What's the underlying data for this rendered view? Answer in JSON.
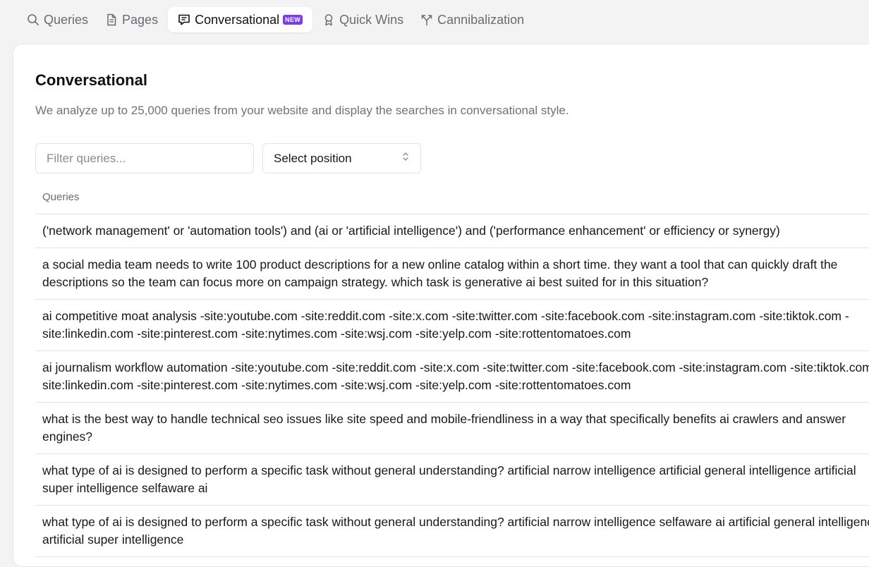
{
  "tabs": [
    {
      "label": "Queries",
      "icon": "search-icon",
      "active": false
    },
    {
      "label": "Pages",
      "icon": "page-icon",
      "active": false
    },
    {
      "label": "Conversational",
      "icon": "chat-icon",
      "active": true,
      "badge": "NEW"
    },
    {
      "label": "Quick Wins",
      "icon": "award-icon",
      "active": false
    },
    {
      "label": "Cannibalization",
      "icon": "split-icon",
      "active": false
    }
  ],
  "panel": {
    "title": "Conversational",
    "subtitle": "We analyze up to 25,000 queries from your website and display the searches in conversational style.",
    "filter_placeholder": "Filter queries...",
    "select_label": "Select position",
    "column_header": "Queries"
  },
  "rows": [
    "('network management' or 'automation tools') and (ai or 'artificial intelligence') and ('performance enhancement' or efficiency or synergy)",
    "a social media team needs to write 100 product descriptions for a new online catalog within a short time. they want a tool that can quickly draft the descriptions so the team can focus more on campaign strategy. which task is generative ai best suited for in this situation?",
    "ai competitive moat analysis -site:youtube.com -site:reddit.com -site:x.com -site:twitter.com -site:facebook.com -site:instagram.com -site:tiktok.com -site:linkedin.com -site:pinterest.com -site:nytimes.com -site:wsj.com -site:yelp.com -site:rottentomatoes.com",
    "ai journalism workflow automation -site:youtube.com -site:reddit.com -site:x.com -site:twitter.com -site:facebook.com -site:instagram.com -site:tiktok.com -site:linkedin.com -site:pinterest.com -site:nytimes.com -site:wsj.com -site:yelp.com -site:rottentomatoes.com",
    "what is the best way to handle technical seo issues like site speed and mobile-friendliness in a way that specifically benefits ai crawlers and answer engines?",
    "what type of ai is designed to perform a specific task without general understanding? artificial narrow intelligence artificial general intelligence artificial super intelligence selfaware ai",
    "what type of ai is designed to perform a specific task without general understanding? artificial narrow intelligence selfaware ai artificial general intelligence artificial super intelligence"
  ],
  "colors": {
    "accent_badge": "#7c3aed",
    "page_bg": "#f3f3f4",
    "panel_bg": "#ffffff"
  }
}
